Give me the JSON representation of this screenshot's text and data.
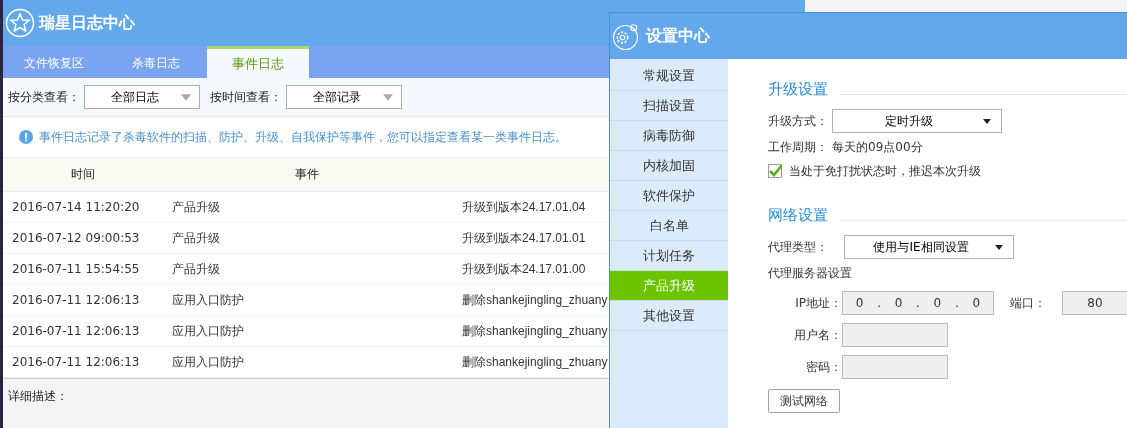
{
  "log_window": {
    "title": "瑞星日志中心",
    "tabs": [
      {
        "label": "文件恢复区",
        "selected": false
      },
      {
        "label": "杀毒日志",
        "selected": false
      },
      {
        "label": "事件日志",
        "selected": true
      }
    ],
    "filters": [
      {
        "label": "按分类查看：",
        "value": "全部日志"
      },
      {
        "label": "按时间查看：",
        "value": "全部记录"
      }
    ],
    "info": "事件日志记录了杀毒软件的扫描、防护、升级、自我保护等事件，您可以指定查看某一类事件日志。",
    "table": {
      "columns": [
        "时间",
        "事件"
      ],
      "rows": [
        [
          "2016-07-14 11:20:20",
          "产品升级",
          "升级到版本24.17.01.04"
        ],
        [
          "2016-07-12 09:00:53",
          "产品升级",
          "升级到版本24.17.01.01"
        ],
        [
          "2016-07-11 15:54:55",
          "产品升级",
          "升级到版本24.17.01.00"
        ],
        [
          "2016-07-11 12:06:13",
          "应用入口防护",
          "删除shankejingling_zhuany"
        ],
        [
          "2016-07-11 12:06:13",
          "应用入口防护",
          "删除shankejingling_zhuany"
        ],
        [
          "2016-07-11 12:06:13",
          "应用入口防护",
          "删除shankejingling_zhuany"
        ]
      ]
    },
    "detail_label": "详细描述："
  },
  "settings_window": {
    "title": "设置中心",
    "sidebar": {
      "items": [
        {
          "label": "常规设置",
          "selected": false
        },
        {
          "label": "扫描设置",
          "selected": false
        },
        {
          "label": "病毒防御",
          "selected": false
        },
        {
          "label": "内核加固",
          "selected": false
        },
        {
          "label": "软件保护",
          "selected": false
        },
        {
          "label": "白名单",
          "selected": false
        },
        {
          "label": "计划任务",
          "selected": false
        },
        {
          "label": "产品升级",
          "selected": true
        },
        {
          "label": "其他设置",
          "selected": false
        }
      ]
    },
    "upgrade": {
      "heading": "升级设置",
      "method_label": "升级方式：",
      "method_value": "定时升级",
      "period_label": "工作周期：",
      "period_value": "每天的09点00分",
      "postpone": {
        "label": "当处于免打扰状态时，推迟本次升级",
        "checked": true
      }
    },
    "network": {
      "heading": "网络设置",
      "proxy_type_label": "代理类型：",
      "proxy_type_value": "使用与IE相同设置",
      "proxy_server_label": "代理服务器设置",
      "ip_label": "IP地址：",
      "ip_parts": [
        "0",
        "0",
        "0",
        "0"
      ],
      "ip_separator": ".",
      "port_label": "端口：",
      "port_value": "80",
      "user_label": "用户名：",
      "password_label": "密码：",
      "test_button": "测试网络"
    }
  }
}
